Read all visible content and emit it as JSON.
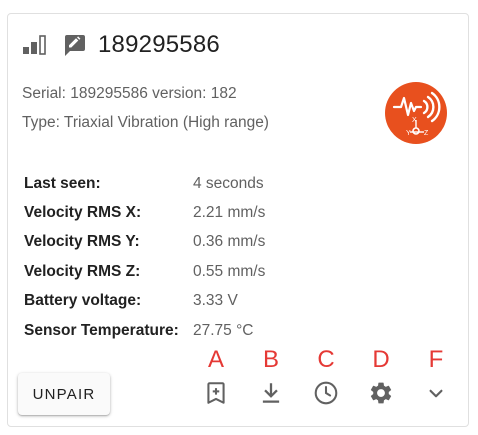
{
  "device": {
    "title": "189295586",
    "serial_line": "Serial: 189295586 version: 182",
    "type_line": "Type: Triaxial Vibration (High range)"
  },
  "properties": [
    {
      "label": "Last seen:",
      "value": "4 seconds"
    },
    {
      "label": "Velocity RMS X:",
      "value": "2.21 mm/s"
    },
    {
      "label": "Velocity RMS Y:",
      "value": "0.36 mm/s"
    },
    {
      "label": "Velocity RMS Z:",
      "value": "0.55 mm/s"
    },
    {
      "label": "Battery voltage:",
      "value": "3.33 V"
    },
    {
      "label": "Sensor Temperature:",
      "value": "27.75 °C"
    }
  ],
  "actions": {
    "unpair_label": "UNPAIR",
    "bookmark_letter": "A",
    "download_letter": "B",
    "history_letter": "C",
    "settings_letter": "D",
    "expand_letter": "F"
  },
  "badge": {
    "axis_x": "X",
    "axis_y": "Y",
    "axis_z": "Z"
  },
  "icons": {
    "signal": "signal-strength-icon",
    "edit": "edit-icon",
    "sensor": "vibration-sensor-icon",
    "bookmark": "bookmark-add-icon",
    "download": "download-icon",
    "history": "clock-icon",
    "settings": "gear-icon",
    "expand": "chevron-down-icon"
  },
  "colors": {
    "accent_orange": "#E8501E",
    "annotation_red": "#E53935",
    "icon_gray": "#616161"
  }
}
